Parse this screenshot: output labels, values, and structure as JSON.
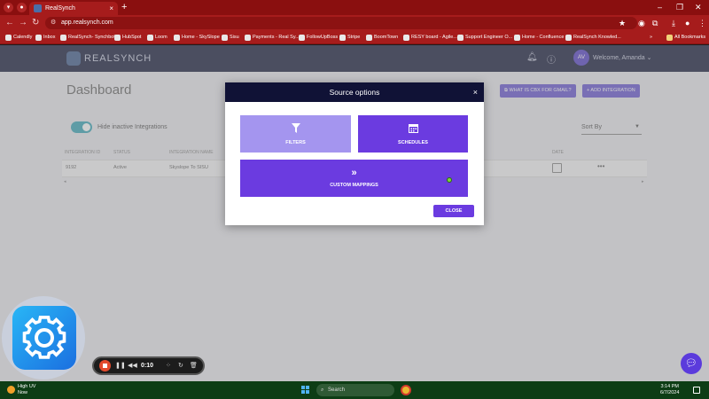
{
  "browser": {
    "tab_title": "RealSynch",
    "url": "app.realsynch.com",
    "all_bookmarks_label": "All Bookmarks",
    "bookmarks": [
      "Calendly",
      "Inbox",
      "RealSynch- Synchbot",
      "HubSpot",
      "Loom",
      "Home - SkySlope",
      "Sisu",
      "Payments - Real Sy...",
      "FollowUpBoss",
      "Stripe",
      "BoomTown",
      "RESY board - Agile...",
      "Support Engineer O...",
      "Home - Confluence",
      "RealSynch Knowled..."
    ]
  },
  "app": {
    "logo_text": "REALSYNCH",
    "avatar_initials": "AV",
    "welcome_text": "Welcome, Amanda",
    "page_title": "Dashboard",
    "cbx_button": "WHAT IS CBX FOR GMAIL?",
    "add_integration_button": "+ ADD INTEGRATION",
    "hide_inactive_label": "Hide inactive Integrations",
    "sort_by_label": "Sort By",
    "table": {
      "headers": [
        "INTEGRATION ID",
        "STATUS",
        "INTEGRATION NAME",
        "DATE"
      ],
      "rows": [
        {
          "id": "9192",
          "status": "Active",
          "name": "Skyslope To SISU"
        }
      ]
    }
  },
  "modal": {
    "title": "Source options",
    "options": [
      {
        "label": "FILTERS",
        "icon": "filter-icon"
      },
      {
        "label": "SCHEDULES",
        "icon": "calendar-icon"
      },
      {
        "label": "CUSTOM MAPPINGS",
        "icon": "double-chevron-right-icon"
      }
    ],
    "close_label": "CLOSE"
  },
  "recorder": {
    "time": "0:10"
  },
  "taskbar": {
    "weather_line1": "High UV",
    "weather_line2": "Now",
    "search_placeholder": "Search",
    "time": "3:14 PM",
    "date": "6/7/2024"
  },
  "colors": {
    "brand_purple": "#6b3be0",
    "light_purple": "#a495ef",
    "modal_header": "#101236",
    "browser_red": "#a61c1c"
  }
}
